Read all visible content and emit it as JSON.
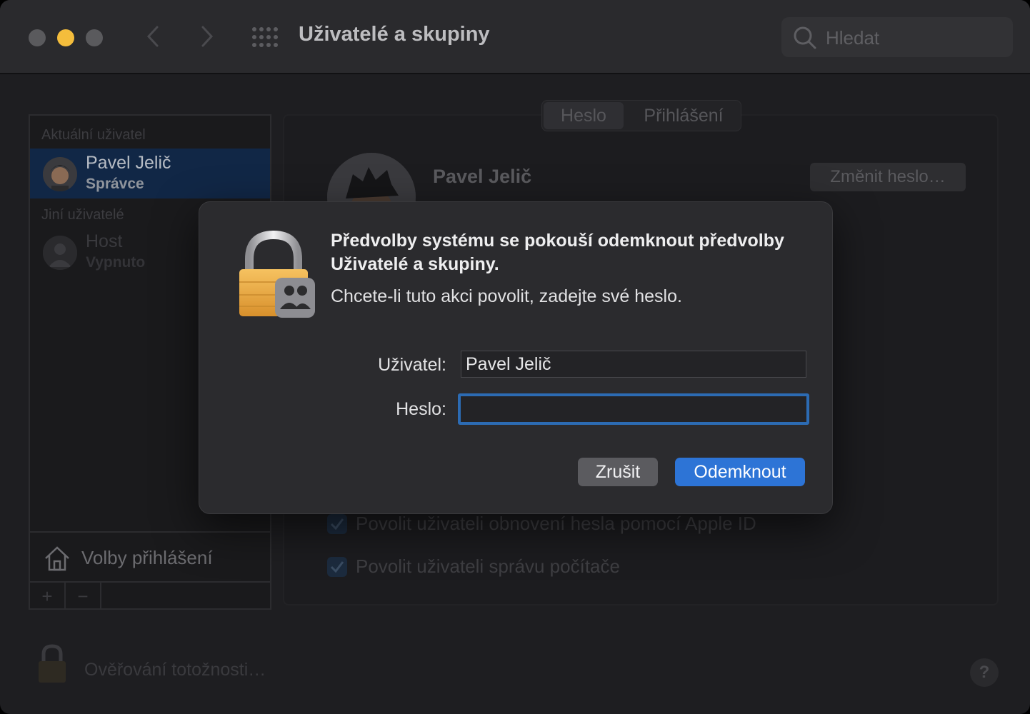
{
  "window": {
    "title": "Uživatelé a skupiny",
    "search_placeholder": "Hledat"
  },
  "sidebar": {
    "current_header": "Aktuální uživatel",
    "current_user": {
      "name": "Pavel Jelič",
      "role": "Správce"
    },
    "other_header": "Jiní uživatelé",
    "other_users": [
      {
        "name": "Host",
        "status": "Vypnuto"
      }
    ],
    "login_options": "Volby přihlášení",
    "add": "+",
    "remove": "−"
  },
  "main": {
    "tabs": [
      "Heslo",
      "Přihlášení"
    ],
    "selected_tab": "Heslo",
    "user_name": "Pavel Jelič",
    "change_password": "Změnit heslo…",
    "checkboxes": [
      {
        "label": "Povolit uživateli obnovení hesla pomocí Apple ID",
        "checked": true
      },
      {
        "label": "Povolit uživateli správu počítače",
        "checked": true
      }
    ]
  },
  "footer": {
    "auth_text": "Ověřování totožnosti…",
    "help": "?"
  },
  "dialog": {
    "title": "Předvolby systému se pokouší odemknout předvolby Uživatelé a skupiny.",
    "subtitle": "Chcete-li tuto akci povolit, zadejte své heslo.",
    "user_label": "Uživatel:",
    "user_value": "Pavel Jelič",
    "password_label": "Heslo:",
    "password_value": "",
    "cancel": "Zrušit",
    "unlock": "Odemknout"
  },
  "colors": {
    "accent": "#2d74d6",
    "selection": "#112746",
    "lock_gold": "#e9a83e"
  }
}
